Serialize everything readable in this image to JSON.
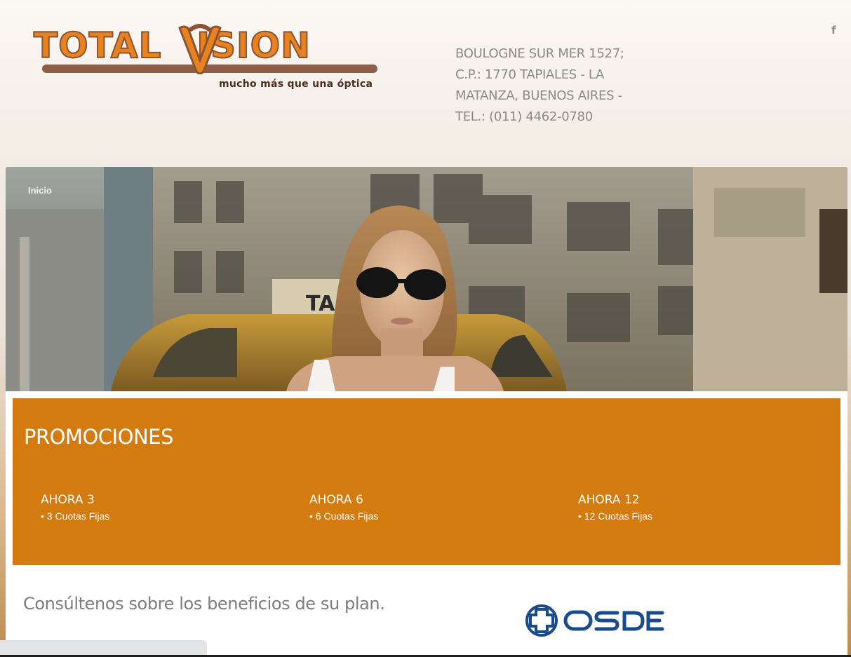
{
  "header": {
    "logo": {
      "name": "TOTALVISION",
      "text_left": "TOTAL",
      "text_right": "ISION",
      "tagline": "mucho más que una óptica"
    },
    "address_lines": [
      "BOULOGNE SUR MER 1527;",
      "C.P.: 1770 TAPIALES - LA",
      "MATANZA, BUENOS AIRES -",
      "TEL.: (011) 4462-0780"
    ],
    "social_icon": "f"
  },
  "nav": {
    "items": [
      {
        "label": "Inicio"
      }
    ]
  },
  "promociones": {
    "title": "PROMOCIONES",
    "items": [
      {
        "title": "AHORA 3",
        "detail": "• 3 Cuotas Fijas"
      },
      {
        "title": "AHORA 6",
        "detail": "• 6 Cuotas Fijas"
      },
      {
        "title": "AHORA 12",
        "detail": "• 12 Cuotas Fijas"
      }
    ]
  },
  "plan": {
    "text": "Consúltenos sobre los beneficios de su plan.",
    "partner_logo_text": "OSDE"
  },
  "colors": {
    "brand_orange": "#e8821e",
    "promo_bg": "#d47b10",
    "logo_brown": "#8e5e48",
    "osde_blue": "#1a4b8c",
    "text_gray": "#8a8a8a"
  }
}
